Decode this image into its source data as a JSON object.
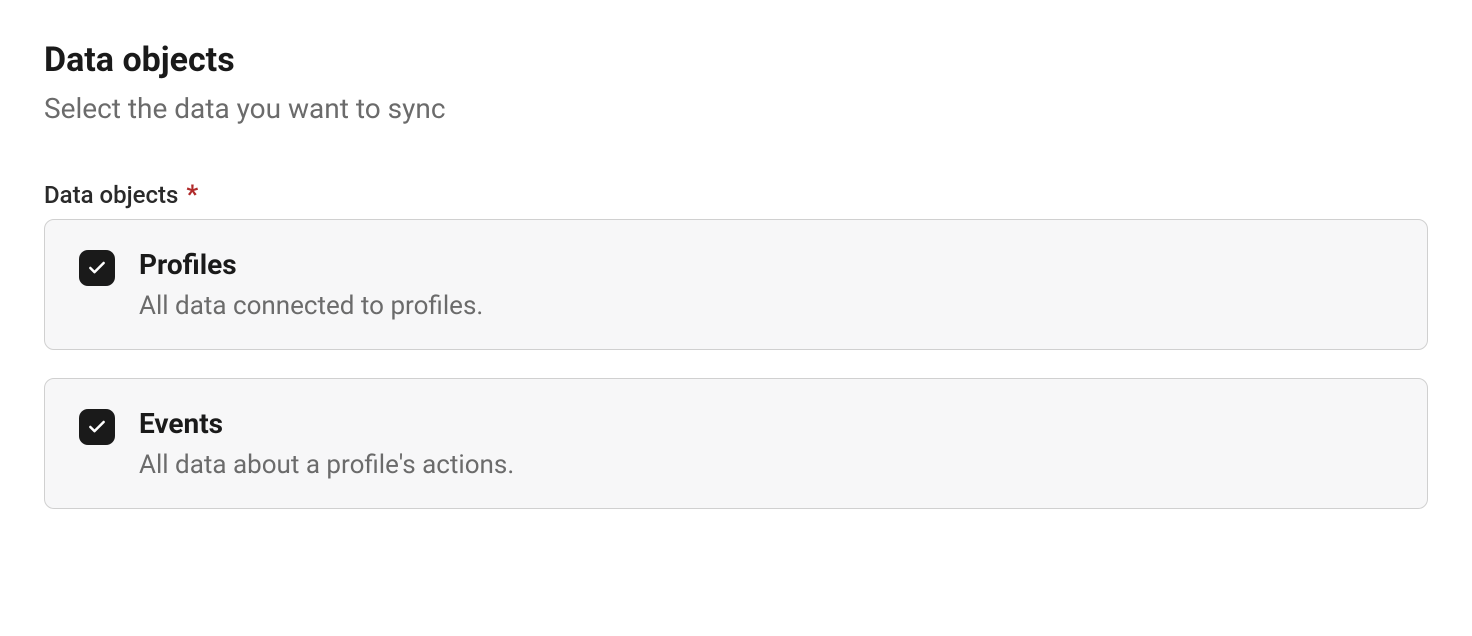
{
  "header": {
    "title": "Data objects",
    "subtitle": "Select the data you want to sync"
  },
  "field": {
    "label": "Data objects",
    "required_mark": "*"
  },
  "options": [
    {
      "title": "Profiles",
      "description": "All data connected to profiles.",
      "checked": true
    },
    {
      "title": "Events",
      "description": "All data about a profile's actions.",
      "checked": true
    }
  ]
}
